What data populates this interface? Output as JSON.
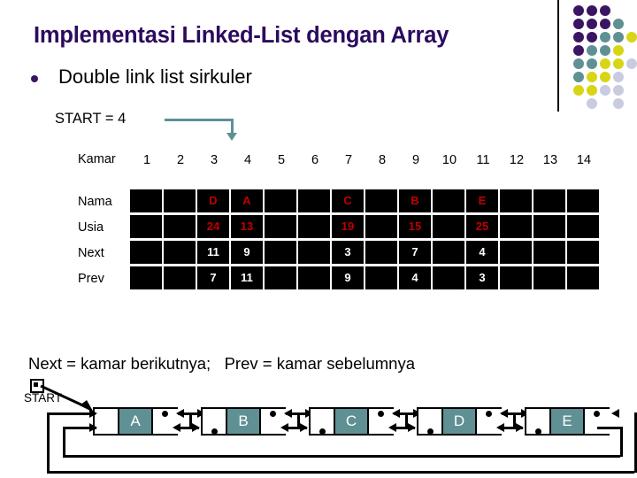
{
  "slide": {
    "title": "Implementasi Linked-List dengan Array",
    "bullet": "Double link list sirkuler",
    "start_label": "START = 4",
    "caption": "Next = kamar berikutnya;   Prev = kamar sebelumnya",
    "start_pointer_label": "START"
  },
  "colors": {
    "title": "#2B0B5E",
    "bullet_dot": "#3B1463",
    "accent_teal": "#5F9094",
    "accent_yellow": "#D8D515",
    "accent_purple": "#3B1463",
    "accent_lavender": "#C9CBE0",
    "cell_bg": "#000000",
    "cell_text_red": "#C00000",
    "cell_text_white": "#FFFFFF"
  },
  "table": {
    "row_labels": [
      "Kamar",
      "Nama",
      "Usia",
      "Next",
      "Prev"
    ],
    "columns": [
      "1",
      "2",
      "3",
      "4",
      "5",
      "6",
      "7",
      "8",
      "9",
      "10",
      "11",
      "12",
      "13",
      "14"
    ],
    "rows": [
      {
        "label": "Nama",
        "style": "red",
        "values": [
          "",
          "",
          "D",
          "A",
          "",
          "",
          "C",
          "",
          "B",
          "",
          "E",
          "",
          "",
          ""
        ]
      },
      {
        "label": "Usia",
        "style": "red",
        "values": [
          "",
          "",
          "24",
          "13",
          "",
          "",
          "19",
          "",
          "15",
          "",
          "25",
          "",
          "",
          ""
        ]
      },
      {
        "label": "Next",
        "style": "white",
        "values": [
          "",
          "",
          "11",
          "9",
          "",
          "",
          "3",
          "",
          "7",
          "",
          "4",
          "",
          "",
          ""
        ]
      },
      {
        "label": "Prev",
        "style": "white",
        "values": [
          "",
          "",
          "7",
          "11",
          "",
          "",
          "9",
          "",
          "4",
          "",
          "3",
          "",
          "",
          ""
        ]
      }
    ]
  },
  "linked_list": {
    "nodes": [
      {
        "value": "A"
      },
      {
        "value": "B"
      },
      {
        "value": "C"
      },
      {
        "value": "D"
      },
      {
        "value": "E"
      }
    ]
  },
  "decoration": {
    "dot_grid": [
      [
        "purple",
        "purple",
        "purple",
        "none",
        "none"
      ],
      [
        "purple",
        "purple",
        "purple",
        "teal",
        "none"
      ],
      [
        "purple",
        "purple",
        "teal",
        "teal",
        "yellow"
      ],
      [
        "purple",
        "teal",
        "teal",
        "yellow",
        "none"
      ],
      [
        "teal",
        "teal",
        "yellow",
        "yellow",
        "lavender"
      ],
      [
        "teal",
        "yellow",
        "yellow",
        "lavender",
        "none"
      ],
      [
        "yellow",
        "yellow",
        "lavender",
        "lavender",
        "none"
      ],
      [
        "none",
        "lavender",
        "none",
        "lavender",
        "none"
      ]
    ]
  }
}
